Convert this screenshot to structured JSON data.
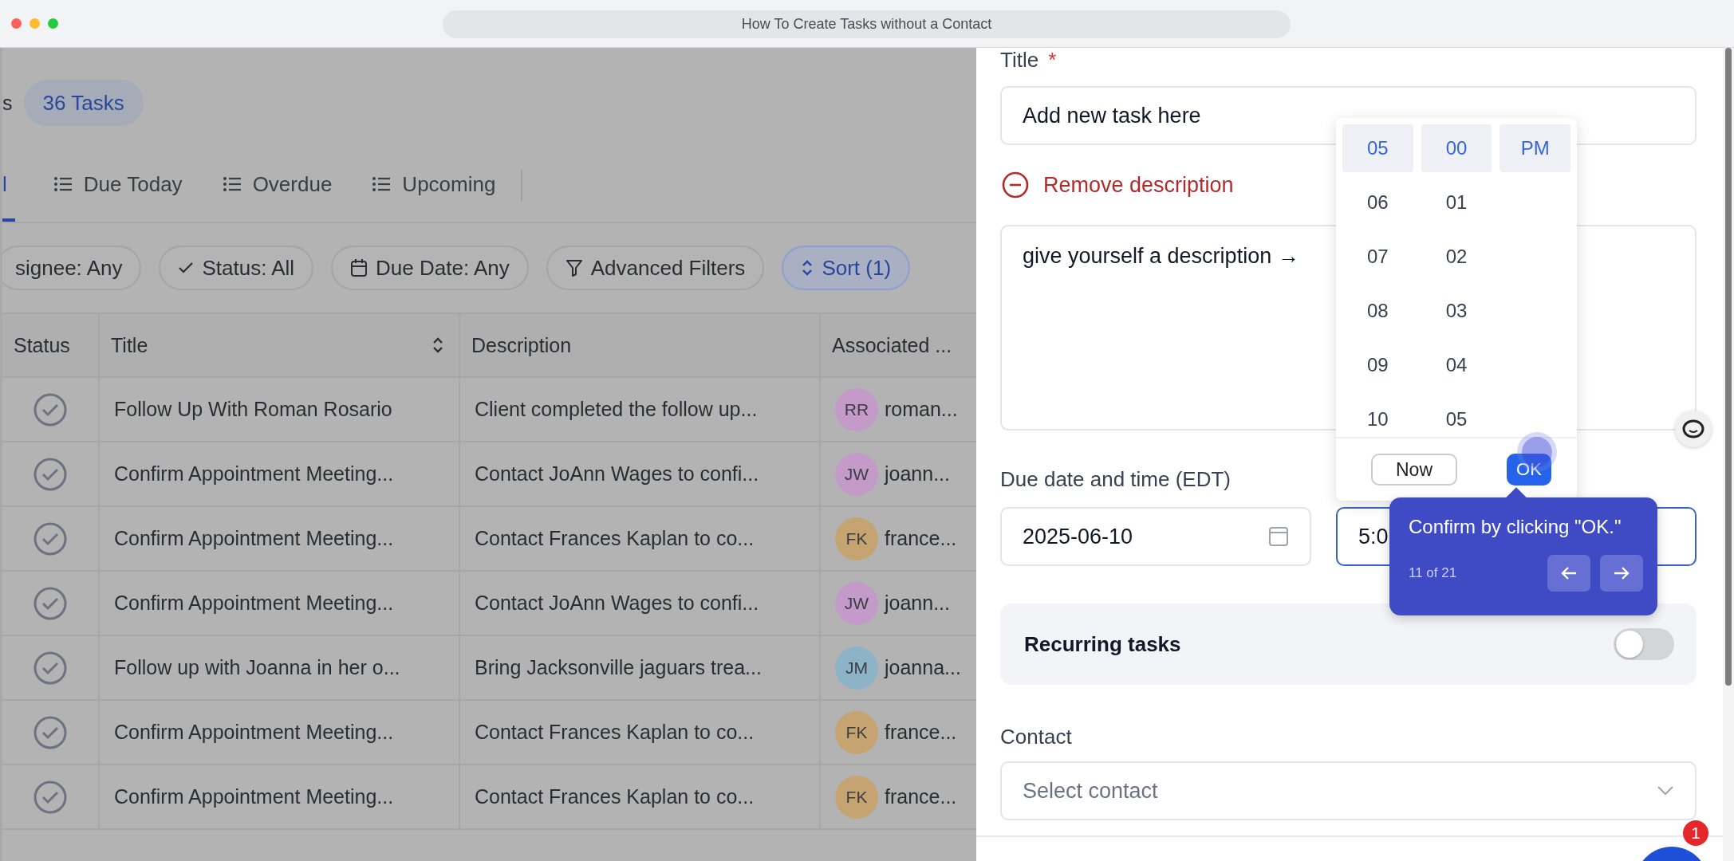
{
  "browser": {
    "title": "How To Create Tasks without a Contact"
  },
  "board": {
    "heading_fragment": "s",
    "count": "36 Tasks",
    "tabs": [
      {
        "label": "l",
        "selected": true,
        "icon": false
      },
      {
        "label": "Due Today",
        "selected": false,
        "icon": true
      },
      {
        "label": "Overdue",
        "selected": false,
        "icon": true
      },
      {
        "label": "Upcoming",
        "selected": false,
        "icon": true
      }
    ],
    "filters": [
      {
        "label": "signee: Any",
        "kind": "plain",
        "active": false
      },
      {
        "label": "Status: All",
        "kind": "check",
        "active": false
      },
      {
        "label": "Due Date: Any",
        "kind": "calendar",
        "active": false
      },
      {
        "label": "Advanced Filters",
        "kind": "funnel",
        "active": false
      },
      {
        "label": "Sort (1)",
        "kind": "sort",
        "active": true
      }
    ]
  },
  "table": {
    "columns": [
      {
        "label": "Status",
        "sortable": false
      },
      {
        "label": "Title",
        "sortable": true
      },
      {
        "label": "Description",
        "sortable": false
      },
      {
        "label": "Associated ...",
        "sortable": false
      }
    ],
    "rows": [
      {
        "title": "Follow Up With Roman Rosario",
        "description": "Client completed the follow up...",
        "initials": "RR",
        "color": "#c49ac9",
        "assignee": "roman..."
      },
      {
        "title": "Confirm Appointment Meeting...",
        "description": "Contact JoAnn Wages to confi...",
        "initials": "JW",
        "color": "#c49ac9",
        "assignee": "joann..."
      },
      {
        "title": "Confirm Appointment Meeting...",
        "description": "Contact Frances Kaplan to co...",
        "initials": "FK",
        "color": "#c6a472",
        "assignee": "france..."
      },
      {
        "title": "Confirm Appointment Meeting...",
        "description": "Contact JoAnn Wages to confi...",
        "initials": "JW",
        "color": "#c49ac9",
        "assignee": "joann..."
      },
      {
        "title": "Follow up with Joanna in her o...",
        "description": "Bring Jacksonville jaguars trea...",
        "initials": "JM",
        "color": "#8db3c8",
        "assignee": "joanna..."
      },
      {
        "title": "Confirm Appointment Meeting...",
        "description": "Contact Frances Kaplan to co...",
        "initials": "FK",
        "color": "#c6a472",
        "assignee": "france..."
      },
      {
        "title": "Confirm Appointment Meeting...",
        "description": "Contact Frances Kaplan to co...",
        "initials": "FK",
        "color": "#c6a472",
        "assignee": "france..."
      }
    ]
  },
  "form": {
    "title_label": "Title",
    "required_mark": "*",
    "title_value": "Add new task here",
    "remove_description": "Remove description",
    "description": "give yourself a description →",
    "due_label": "Due date and time (EDT)",
    "date_value": "2025-06-10",
    "time_value": "5:0",
    "recurring": {
      "label": "Recurring tasks",
      "on": false
    },
    "contact_label": "Contact",
    "contact_placeholder": "Select contact"
  },
  "time_picker": {
    "hours": [
      {
        "label": "05",
        "selected": true
      },
      {
        "label": "06",
        "selected": false
      },
      {
        "label": "07",
        "selected": false
      },
      {
        "label": "08",
        "selected": false
      },
      {
        "label": "09",
        "selected": false
      },
      {
        "label": "10",
        "selected": false
      }
    ],
    "minutes": [
      {
        "label": "00",
        "selected": true
      },
      {
        "label": "01",
        "selected": false
      },
      {
        "label": "02",
        "selected": false
      },
      {
        "label": "03",
        "selected": false
      },
      {
        "label": "04",
        "selected": false
      },
      {
        "label": "05",
        "selected": false
      }
    ],
    "periods": [
      {
        "label": "PM",
        "selected": true
      }
    ],
    "now_button": "Now",
    "ok_button": "OK"
  },
  "tour": {
    "text": "Confirm by clicking \"OK.\"",
    "progress": "11 of 21"
  },
  "notification_badge": "1"
}
